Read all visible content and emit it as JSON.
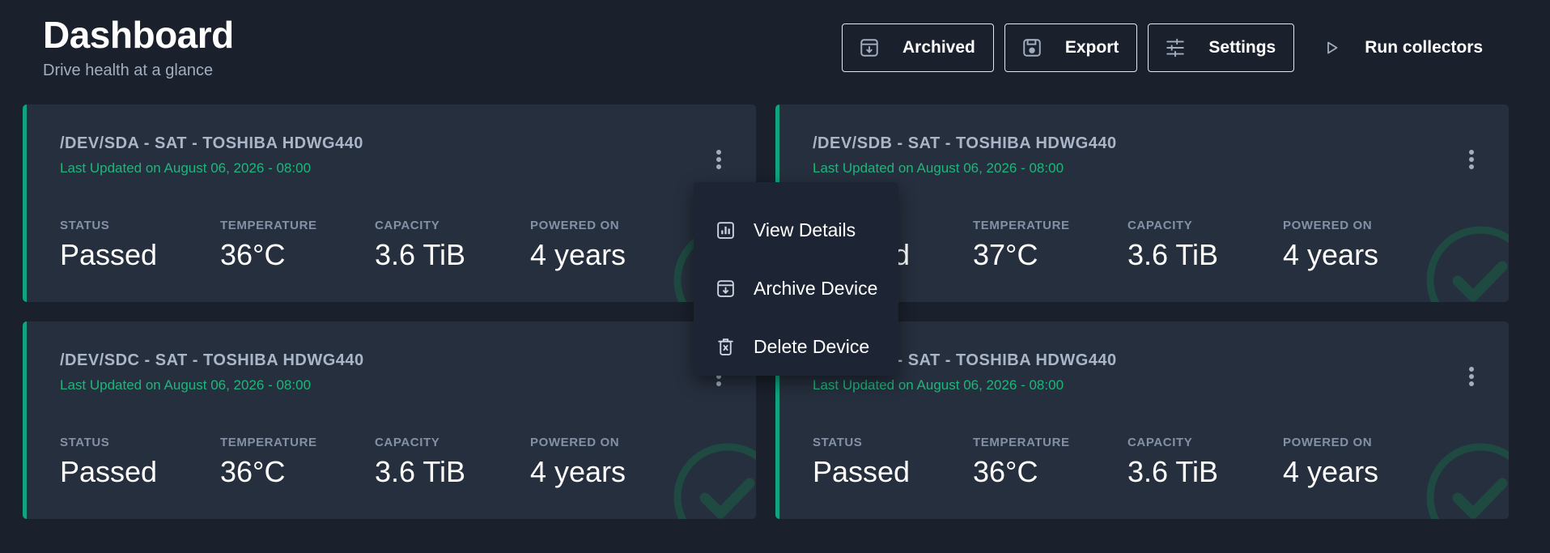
{
  "header": {
    "title": "Dashboard",
    "subtitle": "Drive health at a glance"
  },
  "toolbar": {
    "archived_label": "Archived",
    "export_label": "Export",
    "settings_label": "Settings",
    "run_label": "Run collectors"
  },
  "stat_labels": {
    "status": "STATUS",
    "temperature": "TEMPERATURE",
    "capacity": "CAPACITY",
    "powered_on": "POWERED ON"
  },
  "devices": [
    {
      "title": "/DEV/SDA - SAT - TOSHIBA HDWG440",
      "updated": "Last Updated on August 06, 2026 - 08:00",
      "status": "Passed",
      "temperature": "36°C",
      "capacity": "3.6 TiB",
      "powered_on": "4 years"
    },
    {
      "title": "/DEV/SDB - SAT - TOSHIBA HDWG440",
      "updated": "Last Updated on August 06, 2026 - 08:00",
      "status": "Passed",
      "temperature": "37°C",
      "capacity": "3.6 TiB",
      "powered_on": "4 years"
    },
    {
      "title": "/DEV/SDC - SAT - TOSHIBA HDWG440",
      "updated": "Last Updated on August 06, 2026 - 08:00",
      "status": "Passed",
      "temperature": "36°C",
      "capacity": "3.6 TiB",
      "powered_on": "4 years"
    },
    {
      "title": "/DEV/SDD - SAT - TOSHIBA HDWG440",
      "updated": "Last Updated on August 06, 2026 - 08:00",
      "status": "Passed",
      "temperature": "36°C",
      "capacity": "3.6 TiB",
      "powered_on": "4 years"
    }
  ],
  "context_menu": {
    "view_details": "View Details",
    "archive_device": "Archive Device",
    "delete_device": "Delete Device"
  },
  "colors": {
    "background": "#1a202c",
    "card": "#262f3e",
    "accent_green": "#10a37f",
    "updated_text": "#1fb57b",
    "menu": "#1d2535"
  }
}
